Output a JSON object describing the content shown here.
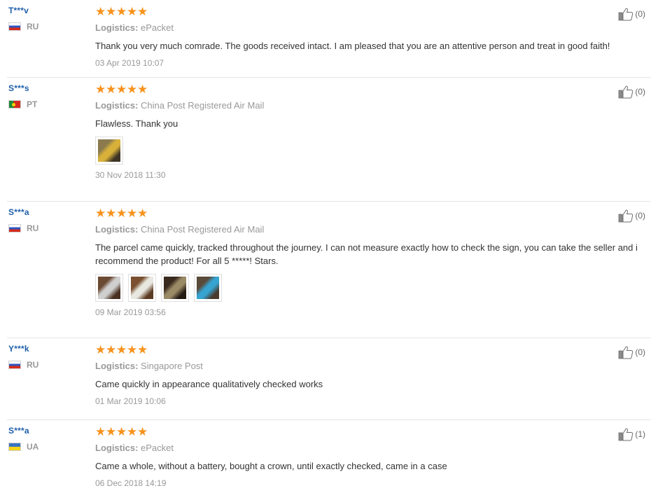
{
  "reviews": [
    {
      "user": "T***v",
      "country": "RU",
      "flag": "ru",
      "rating": 5,
      "logistics_label": "Logistics:",
      "logistics": "ePacket",
      "text": "Thank you very much comrade. The goods received intact. I am pleased that you are an attentive person and treat in good faith!",
      "photos": [],
      "date": "03 Apr 2019 10:07",
      "useful": "(0)"
    },
    {
      "user": "S***s",
      "country": "PT",
      "flag": "pt",
      "rating": 5,
      "logistics_label": "Logistics:",
      "logistics": "China Post Registered Air Mail",
      "text": "Flawless. Thank you",
      "photos": [
        {
          "colors": [
            "#8a7a4e",
            "#d8b13a",
            "#3e3426"
          ]
        }
      ],
      "date": "30 Nov 2018 11:30",
      "useful": "(0)"
    },
    {
      "user": "S***a",
      "country": "RU",
      "flag": "ru",
      "rating": 5,
      "logistics_label": "Logistics:",
      "logistics": "China Post Registered Air Mail",
      "text": "The parcel came quickly, tracked throughout the journey. I can not measure exactly how to check the sign, you can take the seller and i recommend the product! For all 5 *****! Stars.",
      "photos": [
        {
          "colors": [
            "#6b4a33",
            "#cfcfcf",
            "#4a3020"
          ]
        },
        {
          "colors": [
            "#7a5030",
            "#e8e8e0",
            "#5a3a22"
          ]
        },
        {
          "colors": [
            "#3a2a1e",
            "#9a8a66",
            "#231a12"
          ]
        },
        {
          "colors": [
            "#5a4a3a",
            "#36a3d0",
            "#4a3a2e"
          ]
        }
      ],
      "date": "09 Mar 2019 03:56",
      "useful": "(0)"
    },
    {
      "user": "Y***k",
      "country": "RU",
      "flag": "ru",
      "rating": 5,
      "logistics_label": "Logistics:",
      "logistics": "Singapore Post",
      "text": "Came quickly in appearance qualitatively checked works",
      "photos": [],
      "date": "01 Mar 2019 10:06",
      "useful": "(0)"
    },
    {
      "user": "S***a",
      "country": "UA",
      "flag": "ua",
      "rating": 5,
      "logistics_label": "Logistics:",
      "logistics": "ePacket",
      "text": "Came a whole, without a battery, bought a crown, until exactly checked, came in a case",
      "photos": [],
      "date": "06 Dec 2018 14:19",
      "useful": "(1)"
    }
  ],
  "icons": {
    "star": "star-icon",
    "useful": "thumbs-up-icon"
  },
  "colors": {
    "star": "#f7931e",
    "username": "#1f5fa8",
    "muted": "#999999"
  }
}
